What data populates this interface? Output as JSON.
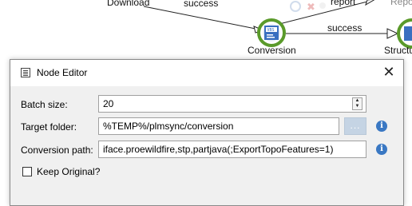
{
  "canvas": {
    "nodes": {
      "download_label": "Download",
      "report_label": "report",
      "report_right_label": "Repo",
      "conversion_label": "Conversion",
      "structure_label": "Structu"
    },
    "edges": {
      "success_top": "success",
      "success_right": "success"
    }
  },
  "dialog": {
    "title": "Node Editor",
    "close_glyph": "✕",
    "fields": {
      "batch_size": {
        "label": "Batch size:",
        "value": "20"
      },
      "target_folder": {
        "label": "Target folder:",
        "value": "%TEMP%/plmsync/conversion",
        "browse_label": "..."
      },
      "conversion_path": {
        "label": "Conversion path:",
        "value": "iface.proewildfire,stp,partjava(;ExportTopoFeatures=1)"
      },
      "keep_original": {
        "label": "Keep Original?",
        "checked": false
      }
    },
    "info_glyph": "i"
  },
  "colors": {
    "node_ring": "#5a9a2a",
    "node_fill": "#3a6fc0",
    "browse_button": "#c5d4e4",
    "info": "#3a78c3"
  }
}
